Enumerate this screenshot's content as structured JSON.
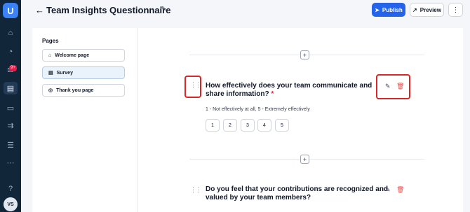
{
  "nav": {
    "logo": "U",
    "badge": "9+",
    "avatar": "VS",
    "items": [
      {
        "icon": "home-icon",
        "glyph": "⌂"
      },
      {
        "icon": "pie-chart-icon",
        "glyph": "◔"
      },
      {
        "icon": "inbox-icon",
        "glyph": "✉"
      },
      {
        "icon": "clipboard-icon",
        "glyph": "▤"
      },
      {
        "icon": "folder-icon",
        "glyph": "▭"
      },
      {
        "icon": "shuffle-icon",
        "glyph": "⇉"
      },
      {
        "icon": "database-icon",
        "glyph": "☰"
      },
      {
        "icon": "more-icon",
        "glyph": "···"
      },
      {
        "icon": "help-icon",
        "glyph": "?"
      }
    ]
  },
  "header": {
    "back_icon": "←",
    "title": "Team Insights Questionnaire",
    "edit_icon": "✎",
    "publish_label": "Publish",
    "preview_label": "Preview",
    "more_icon": "⋮"
  },
  "pages": {
    "title": "Pages",
    "items": [
      {
        "label": "Welcome page",
        "icon": "home-icon",
        "active": false
      },
      {
        "label": "Survey",
        "icon": "document-icon",
        "active": true
      },
      {
        "label": "Thank you page",
        "icon": "check-circle-icon",
        "active": false
      }
    ]
  },
  "questions": [
    {
      "text_line1": "How effectively does your team communicate and",
      "text_line2": "share information?",
      "required_mark": "*",
      "scale_label": "1 - Not effectively at all, 5 - Extremely effectively",
      "options": [
        "1",
        "2",
        "3",
        "4",
        "5"
      ]
    },
    {
      "text_line1": "Do you feel that your contributions are recognized and",
      "text_line2": "valued by your team members?"
    }
  ],
  "colors": {
    "accent": "#2563eb",
    "highlight": "#dc2626",
    "rail": "#12263a"
  }
}
